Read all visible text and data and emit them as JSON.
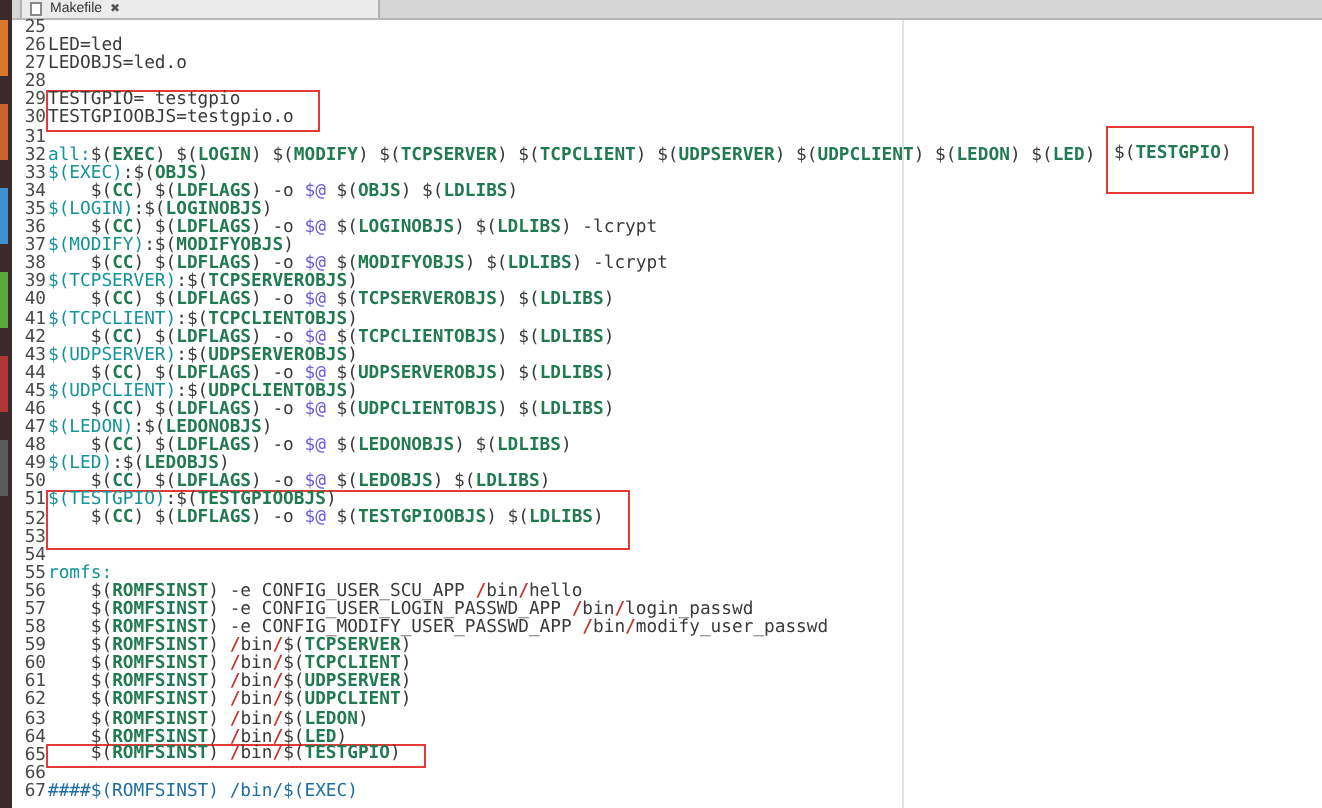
{
  "tab": {
    "title": "Makefile",
    "close": "✖"
  },
  "lines": [
    {
      "number": "25",
      "boxed": false
    },
    {
      "number": "26",
      "boxed": false,
      "segments": [
        {
          "text": "LED=led",
          "kind": "plain"
        }
      ]
    },
    {
      "number": "27",
      "boxed": false,
      "segments": [
        {
          "text": "LEDOBJS=led.o",
          "kind": "plain"
        }
      ]
    },
    {
      "number": "28",
      "boxed": false
    },
    {
      "number": "29",
      "boxed": true,
      "segments": [
        {
          "text": "TESTGPIO= testgpio",
          "kind": "plain"
        }
      ]
    },
    {
      "number": "30",
      "boxed": true,
      "segments": [
        {
          "text": "TESTGPIOOBJS=testgpio.o",
          "kind": "plain"
        }
      ]
    },
    {
      "number": "31",
      "boxed": false
    },
    {
      "number": "32",
      "boxed": false,
      "segments": [
        {
          "text": "all:",
          "kind": "target"
        },
        {
          "text": "$(",
          "kind": "plain"
        },
        {
          "text": "EXEC",
          "kind": "name"
        },
        {
          "text": ") $(",
          "kind": "plain"
        },
        {
          "text": "LOGIN",
          "kind": "name"
        },
        {
          "text": ") $(",
          "kind": "plain"
        },
        {
          "text": "MODIFY",
          "kind": "name"
        },
        {
          "text": ") $(",
          "kind": "plain"
        },
        {
          "text": "TCPSERVER",
          "kind": "name"
        },
        {
          "text": ") $(",
          "kind": "plain"
        },
        {
          "text": "TCPCLIENT",
          "kind": "name"
        },
        {
          "text": ") $(",
          "kind": "plain"
        },
        {
          "text": "UDPSERVER",
          "kind": "name"
        },
        {
          "text": ") $(",
          "kind": "plain"
        },
        {
          "text": "UDPCLIENT",
          "kind": "name"
        },
        {
          "text": ") $(",
          "kind": "plain"
        },
        {
          "text": "LEDON",
          "kind": "name"
        },
        {
          "text": ") $(",
          "kind": "plain"
        },
        {
          "text": "LED",
          "kind": "name"
        },
        {
          "text": ") ",
          "kind": "plain"
        },
        {
          "text": "$(",
          "kind": "plain",
          "boxed": true
        },
        {
          "text": "TESTGPIO",
          "kind": "name",
          "boxed": true
        },
        {
          "text": ")",
          "kind": "plain",
          "boxed": true
        }
      ]
    },
    {
      "number": "33",
      "boxed": false,
      "segments": [
        {
          "text": "$(EXEC)",
          "kind": "target"
        },
        {
          "text": ":$(",
          "kind": "plain"
        },
        {
          "text": "OBJS",
          "kind": "name"
        },
        {
          "text": ")",
          "kind": "plain"
        }
      ]
    },
    {
      "number": "34",
      "boxed": false,
      "segments": [
        {
          "text": "    $(",
          "kind": "plain"
        },
        {
          "text": "CC",
          "kind": "name"
        },
        {
          "text": ") $(",
          "kind": "plain"
        },
        {
          "text": "LDFLAGS",
          "kind": "name"
        },
        {
          "text": ") -o ",
          "kind": "plain"
        },
        {
          "text": "$@",
          "kind": "auto"
        },
        {
          "text": " $(",
          "kind": "plain"
        },
        {
          "text": "OBJS",
          "kind": "name"
        },
        {
          "text": ") $(",
          "kind": "plain"
        },
        {
          "text": "LDLIBS",
          "kind": "name"
        },
        {
          "text": ")",
          "kind": "plain"
        }
      ]
    },
    {
      "number": "35",
      "boxed": false,
      "segments": [
        {
          "text": "$(LOGIN)",
          "kind": "target"
        },
        {
          "text": ":$(",
          "kind": "plain"
        },
        {
          "text": "LOGINOBJS",
          "kind": "name"
        },
        {
          "text": ")",
          "kind": "plain"
        }
      ]
    },
    {
      "number": "36",
      "boxed": false,
      "segments": [
        {
          "text": "    $(",
          "kind": "plain"
        },
        {
          "text": "CC",
          "kind": "name"
        },
        {
          "text": ") $(",
          "kind": "plain"
        },
        {
          "text": "LDFLAGS",
          "kind": "name"
        },
        {
          "text": ") -o ",
          "kind": "plain"
        },
        {
          "text": "$@",
          "kind": "auto"
        },
        {
          "text": " $(",
          "kind": "plain"
        },
        {
          "text": "LOGINOBJS",
          "kind": "name"
        },
        {
          "text": ") $(",
          "kind": "plain"
        },
        {
          "text": "LDLIBS",
          "kind": "name"
        },
        {
          "text": ") -lcrypt",
          "kind": "plain"
        }
      ]
    },
    {
      "number": "37",
      "boxed": false,
      "segments": [
        {
          "text": "$(MODIFY)",
          "kind": "target"
        },
        {
          "text": ":$(",
          "kind": "plain"
        },
        {
          "text": "MODIFYOBJS",
          "kind": "name"
        },
        {
          "text": ")",
          "kind": "plain"
        }
      ]
    },
    {
      "number": "38",
      "boxed": false,
      "segments": [
        {
          "text": "    $(",
          "kind": "plain"
        },
        {
          "text": "CC",
          "kind": "name"
        },
        {
          "text": ") $(",
          "kind": "plain"
        },
        {
          "text": "LDFLAGS",
          "kind": "name"
        },
        {
          "text": ") -o ",
          "kind": "plain"
        },
        {
          "text": "$@",
          "kind": "auto"
        },
        {
          "text": " $(",
          "kind": "plain"
        },
        {
          "text": "MODIFYOBJS",
          "kind": "name"
        },
        {
          "text": ") $(",
          "kind": "plain"
        },
        {
          "text": "LDLIBS",
          "kind": "name"
        },
        {
          "text": ") -lcrypt",
          "kind": "plain"
        }
      ]
    },
    {
      "number": "39",
      "boxed": false,
      "segments": [
        {
          "text": "$(TCPSERVER)",
          "kind": "target"
        },
        {
          "text": ":$(",
          "kind": "plain"
        },
        {
          "text": "TCPSERVEROBJS",
          "kind": "name"
        },
        {
          "text": ")",
          "kind": "plain"
        }
      ]
    },
    {
      "number": "40",
      "boxed": false,
      "segments": [
        {
          "text": "    $(",
          "kind": "plain"
        },
        {
          "text": "CC",
          "kind": "name"
        },
        {
          "text": ") $(",
          "kind": "plain"
        },
        {
          "text": "LDFLAGS",
          "kind": "name"
        },
        {
          "text": ") -o ",
          "kind": "plain"
        },
        {
          "text": "$@",
          "kind": "auto"
        },
        {
          "text": " $(",
          "kind": "plain"
        },
        {
          "text": "TCPSERVEROBJS",
          "kind": "name"
        },
        {
          "text": ") $(",
          "kind": "plain"
        },
        {
          "text": "LDLIBS",
          "kind": "name"
        },
        {
          "text": ")",
          "kind": "plain"
        }
      ]
    },
    {
      "number": "41",
      "boxed": false,
      "segments": [
        {
          "text": "$(TCPCLIENT)",
          "kind": "target"
        },
        {
          "text": ":$(",
          "kind": "plain"
        },
        {
          "text": "TCPCLIENTOBJS",
          "kind": "name"
        },
        {
          "text": ")",
          "kind": "plain"
        }
      ]
    },
    {
      "number": "42",
      "boxed": false,
      "segments": [
        {
          "text": "    $(",
          "kind": "plain"
        },
        {
          "text": "CC",
          "kind": "name"
        },
        {
          "text": ") $(",
          "kind": "plain"
        },
        {
          "text": "LDFLAGS",
          "kind": "name"
        },
        {
          "text": ") -o ",
          "kind": "plain"
        },
        {
          "text": "$@",
          "kind": "auto"
        },
        {
          "text": " $(",
          "kind": "plain"
        },
        {
          "text": "TCPCLIENTOBJS",
          "kind": "name"
        },
        {
          "text": ") $(",
          "kind": "plain"
        },
        {
          "text": "LDLIBS",
          "kind": "name"
        },
        {
          "text": ")",
          "kind": "plain"
        }
      ]
    },
    {
      "number": "43",
      "boxed": false,
      "segments": [
        {
          "text": "$(UDPSERVER)",
          "kind": "target"
        },
        {
          "text": ":$(",
          "kind": "plain"
        },
        {
          "text": "UDPSERVEROBJS",
          "kind": "name"
        },
        {
          "text": ")",
          "kind": "plain"
        }
      ]
    },
    {
      "number": "44",
      "boxed": false,
      "segments": [
        {
          "text": "    $(",
          "kind": "plain"
        },
        {
          "text": "CC",
          "kind": "name"
        },
        {
          "text": ") $(",
          "kind": "plain"
        },
        {
          "text": "LDFLAGS",
          "kind": "name"
        },
        {
          "text": ") -o ",
          "kind": "plain"
        },
        {
          "text": "$@",
          "kind": "auto"
        },
        {
          "text": " $(",
          "kind": "plain"
        },
        {
          "text": "UDPSERVEROBJS",
          "kind": "name"
        },
        {
          "text": ") $(",
          "kind": "plain"
        },
        {
          "text": "LDLIBS",
          "kind": "name"
        },
        {
          "text": ")",
          "kind": "plain"
        }
      ]
    },
    {
      "number": "45",
      "boxed": false,
      "segments": [
        {
          "text": "$(UDPCLIENT)",
          "kind": "target"
        },
        {
          "text": ":$(",
          "kind": "plain"
        },
        {
          "text": "UDPCLIENTOBJS",
          "kind": "name"
        },
        {
          "text": ")",
          "kind": "plain"
        }
      ]
    },
    {
      "number": "46",
      "boxed": false,
      "segments": [
        {
          "text": "    $(",
          "kind": "plain"
        },
        {
          "text": "CC",
          "kind": "name"
        },
        {
          "text": ") $(",
          "kind": "plain"
        },
        {
          "text": "LDFLAGS",
          "kind": "name"
        },
        {
          "text": ") -o ",
          "kind": "plain"
        },
        {
          "text": "$@",
          "kind": "auto"
        },
        {
          "text": " $(",
          "kind": "plain"
        },
        {
          "text": "UDPCLIENTOBJS",
          "kind": "name"
        },
        {
          "text": ") $(",
          "kind": "plain"
        },
        {
          "text": "LDLIBS",
          "kind": "name"
        },
        {
          "text": ")",
          "kind": "plain"
        }
      ]
    },
    {
      "number": "47",
      "boxed": false,
      "segments": [
        {
          "text": "$(LEDON)",
          "kind": "target"
        },
        {
          "text": ":$(",
          "kind": "plain"
        },
        {
          "text": "LEDONOBJS",
          "kind": "name"
        },
        {
          "text": ")",
          "kind": "plain"
        }
      ]
    },
    {
      "number": "48",
      "boxed": false,
      "segments": [
        {
          "text": "    $(",
          "kind": "plain"
        },
        {
          "text": "CC",
          "kind": "name"
        },
        {
          "text": ") $(",
          "kind": "plain"
        },
        {
          "text": "LDFLAGS",
          "kind": "name"
        },
        {
          "text": ") -o ",
          "kind": "plain"
        },
        {
          "text": "$@",
          "kind": "auto"
        },
        {
          "text": " $(",
          "kind": "plain"
        },
        {
          "text": "LEDONOBJS",
          "kind": "name"
        },
        {
          "text": ") $(",
          "kind": "plain"
        },
        {
          "text": "LDLIBS",
          "kind": "name"
        },
        {
          "text": ")",
          "kind": "plain"
        }
      ]
    },
    {
      "number": "49",
      "boxed": false,
      "segments": [
        {
          "text": "$(LED)",
          "kind": "target"
        },
        {
          "text": ":$(",
          "kind": "plain"
        },
        {
          "text": "LEDOBJS",
          "kind": "name"
        },
        {
          "text": ")",
          "kind": "plain"
        }
      ]
    },
    {
      "number": "50",
      "boxed": false,
      "segments": [
        {
          "text": "    $(",
          "kind": "plain"
        },
        {
          "text": "CC",
          "kind": "name"
        },
        {
          "text": ") $(",
          "kind": "plain"
        },
        {
          "text": "LDFLAGS",
          "kind": "name"
        },
        {
          "text": ") -o ",
          "kind": "plain"
        },
        {
          "text": "$@",
          "kind": "auto"
        },
        {
          "text": " $(",
          "kind": "plain"
        },
        {
          "text": "LEDOBJS",
          "kind": "name"
        },
        {
          "text": ") $(",
          "kind": "plain"
        },
        {
          "text": "LDLIBS",
          "kind": "name"
        },
        {
          "text": ")",
          "kind": "plain"
        }
      ]
    },
    {
      "number": "51",
      "boxed": true,
      "segments": [
        {
          "text": "$(TESTGPIO)",
          "kind": "target"
        },
        {
          "text": ":$(",
          "kind": "plain"
        },
        {
          "text": "TESTGPIOOBJS",
          "kind": "name"
        },
        {
          "text": ")",
          "kind": "plain"
        }
      ]
    },
    {
      "number": "52",
      "boxed": true,
      "segments": [
        {
          "text": "    $(",
          "kind": "plain"
        },
        {
          "text": "CC",
          "kind": "name"
        },
        {
          "text": ") $(",
          "kind": "plain"
        },
        {
          "text": "LDFLAGS",
          "kind": "name"
        },
        {
          "text": ") -o ",
          "kind": "plain"
        },
        {
          "text": "$@",
          "kind": "auto"
        },
        {
          "text": " $(",
          "kind": "plain"
        },
        {
          "text": "TESTGPIOOBJS",
          "kind": "name"
        },
        {
          "text": ") $(",
          "kind": "plain"
        },
        {
          "text": "LDLIBS",
          "kind": "name"
        },
        {
          "text": ")",
          "kind": "plain"
        }
      ]
    },
    {
      "number": "53",
      "boxed": true
    },
    {
      "number": "54",
      "boxed": false
    },
    {
      "number": "55",
      "boxed": false,
      "segments": [
        {
          "text": "romfs:",
          "kind": "target"
        }
      ]
    },
    {
      "number": "56",
      "boxed": false,
      "segments": [
        {
          "text": "    $(",
          "kind": "plain"
        },
        {
          "text": "ROMFSINST",
          "kind": "name"
        },
        {
          "text": ") -e CONFIG_USER_SCU_APP ",
          "kind": "plain"
        },
        {
          "text": "/",
          "kind": "slash"
        },
        {
          "text": "bin",
          "kind": "plain"
        },
        {
          "text": "/",
          "kind": "slash"
        },
        {
          "text": "hello",
          "kind": "plain"
        }
      ]
    },
    {
      "number": "57",
      "boxed": false,
      "segments": [
        {
          "text": "    $(",
          "kind": "plain"
        },
        {
          "text": "ROMFSINST",
          "kind": "name"
        },
        {
          "text": ") -e CONFIG_USER_LOGIN_PASSWD_APP ",
          "kind": "plain"
        },
        {
          "text": "/",
          "kind": "slash"
        },
        {
          "text": "bin",
          "kind": "plain"
        },
        {
          "text": "/",
          "kind": "slash"
        },
        {
          "text": "login_passwd",
          "kind": "plain"
        }
      ]
    },
    {
      "number": "58",
      "boxed": false,
      "segments": [
        {
          "text": "    $(",
          "kind": "plain"
        },
        {
          "text": "ROMFSINST",
          "kind": "name"
        },
        {
          "text": ") -e CONFIG_MODIFY_USER_PASSWD_APP ",
          "kind": "plain"
        },
        {
          "text": "/",
          "kind": "slash"
        },
        {
          "text": "bin",
          "kind": "plain"
        },
        {
          "text": "/",
          "kind": "slash"
        },
        {
          "text": "modify_user_passwd",
          "kind": "plain"
        }
      ]
    },
    {
      "number": "59",
      "boxed": false,
      "segments": [
        {
          "text": "    $(",
          "kind": "plain"
        },
        {
          "text": "ROMFSINST",
          "kind": "name"
        },
        {
          "text": ") ",
          "kind": "plain"
        },
        {
          "text": "/",
          "kind": "slash"
        },
        {
          "text": "bin",
          "kind": "plain"
        },
        {
          "text": "/",
          "kind": "slash"
        },
        {
          "text": "$(",
          "kind": "plain"
        },
        {
          "text": "TCPSERVER",
          "kind": "name"
        },
        {
          "text": ")",
          "kind": "plain"
        }
      ]
    },
    {
      "number": "60",
      "boxed": false,
      "segments": [
        {
          "text": "    $(",
          "kind": "plain"
        },
        {
          "text": "ROMFSINST",
          "kind": "name"
        },
        {
          "text": ") ",
          "kind": "plain"
        },
        {
          "text": "/",
          "kind": "slash"
        },
        {
          "text": "bin",
          "kind": "plain"
        },
        {
          "text": "/",
          "kind": "slash"
        },
        {
          "text": "$(",
          "kind": "plain"
        },
        {
          "text": "TCPCLIENT",
          "kind": "name"
        },
        {
          "text": ")",
          "kind": "plain"
        }
      ]
    },
    {
      "number": "61",
      "boxed": false,
      "segments": [
        {
          "text": "    $(",
          "kind": "plain"
        },
        {
          "text": "ROMFSINST",
          "kind": "name"
        },
        {
          "text": ") ",
          "kind": "plain"
        },
        {
          "text": "/",
          "kind": "slash"
        },
        {
          "text": "bin",
          "kind": "plain"
        },
        {
          "text": "/",
          "kind": "slash"
        },
        {
          "text": "$(",
          "kind": "plain"
        },
        {
          "text": "UDPSERVER",
          "kind": "name"
        },
        {
          "text": ")",
          "kind": "plain"
        }
      ]
    },
    {
      "number": "62",
      "boxed": false,
      "segments": [
        {
          "text": "    $(",
          "kind": "plain"
        },
        {
          "text": "ROMFSINST",
          "kind": "name"
        },
        {
          "text": ") ",
          "kind": "plain"
        },
        {
          "text": "/",
          "kind": "slash"
        },
        {
          "text": "bin",
          "kind": "plain"
        },
        {
          "text": "/",
          "kind": "slash"
        },
        {
          "text": "$(",
          "kind": "plain"
        },
        {
          "text": "UDPCLIENT",
          "kind": "name"
        },
        {
          "text": ")",
          "kind": "plain"
        }
      ]
    },
    {
      "number": "63",
      "boxed": false,
      "segments": [
        {
          "text": "    $(",
          "kind": "plain"
        },
        {
          "text": "ROMFSINST",
          "kind": "name"
        },
        {
          "text": ") ",
          "kind": "plain"
        },
        {
          "text": "/",
          "kind": "slash"
        },
        {
          "text": "bin",
          "kind": "plain"
        },
        {
          "text": "/",
          "kind": "slash"
        },
        {
          "text": "$(",
          "kind": "plain"
        },
        {
          "text": "LEDON",
          "kind": "name"
        },
        {
          "text": ")",
          "kind": "plain"
        }
      ]
    },
    {
      "number": "64",
      "boxed": false,
      "segments": [
        {
          "text": "    $(",
          "kind": "plain"
        },
        {
          "text": "ROMFSINST",
          "kind": "name"
        },
        {
          "text": ") ",
          "kind": "plain"
        },
        {
          "text": "/",
          "kind": "slash"
        },
        {
          "text": "bin",
          "kind": "plain"
        },
        {
          "text": "/",
          "kind": "slash"
        },
        {
          "text": "$(",
          "kind": "plain"
        },
        {
          "text": "LED",
          "kind": "name"
        },
        {
          "text": ")",
          "kind": "plain"
        }
      ]
    },
    {
      "number": "65",
      "boxed": true,
      "segments": [
        {
          "text": "    $(",
          "kind": "plain"
        },
        {
          "text": "ROMFSINST",
          "kind": "name"
        },
        {
          "text": ") ",
          "kind": "plain"
        },
        {
          "text": "/",
          "kind": "slash"
        },
        {
          "text": "bin",
          "kind": "plain"
        },
        {
          "text": "/",
          "kind": "slash"
        },
        {
          "text": "$(",
          "kind": "plain"
        },
        {
          "text": "TESTGPIO",
          "kind": "name"
        },
        {
          "text": ")",
          "kind": "plain"
        }
      ]
    },
    {
      "number": "66",
      "boxed": false
    },
    {
      "number": "67",
      "boxed": false,
      "segments": [
        {
          "text": "####$(ROMFSINST) /bin/$(EXEC)",
          "kind": "comment"
        }
      ]
    }
  ]
}
